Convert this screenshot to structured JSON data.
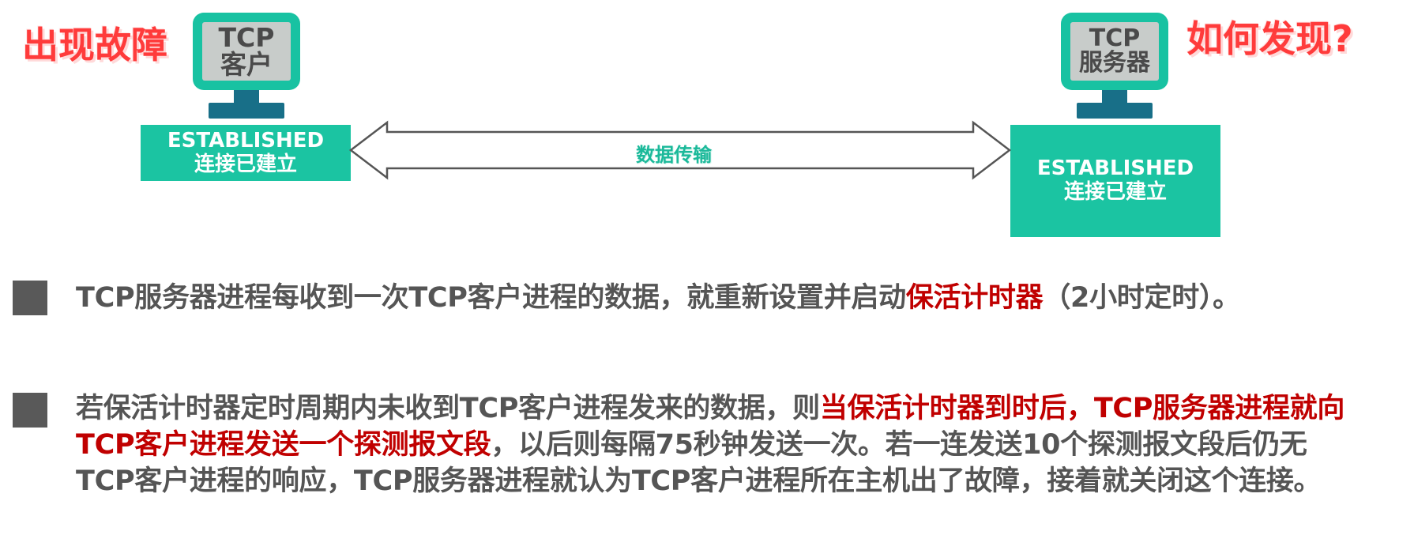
{
  "left_callout": "出现故障",
  "right_callout": "如何发现?",
  "client": {
    "screen_line1": "TCP",
    "screen_line2": "客户",
    "state_line1": "ESTABLISHED",
    "state_line2": "连接已建立"
  },
  "server": {
    "screen_line1": "TCP",
    "screen_line2": "服务器",
    "state_line1": "ESTABLISHED",
    "state_line2": "连接已建立"
  },
  "arrow_label": "数据传输",
  "bullet1": {
    "text_a": "TCP服务器进程每收到一次TCP客户进程的数据，就重新设置并启动",
    "highlight": "保活计时器",
    "text_b": "（2小时定时）。"
  },
  "bullet2": {
    "text_a": "若保活计时器定时周期内未收到TCP客户进程发来的数据，则",
    "highlight": "当保活计时器到时后，TCP服务器进程就向TCP客户进程发送一个探测报文段",
    "text_b": "，以后则每隔75秒钟发送一次。若一连发送10个探测报文段后仍无TCP客户进程的响应，TCP服务器进程就认为TCP客户进程所在主机出了故障，接着就关闭这个连接。"
  },
  "colors": {
    "teal": "#1bc4a2",
    "callout_red": "#ff3b3b",
    "highlight_red": "#c00000",
    "body_text": "#555555"
  }
}
